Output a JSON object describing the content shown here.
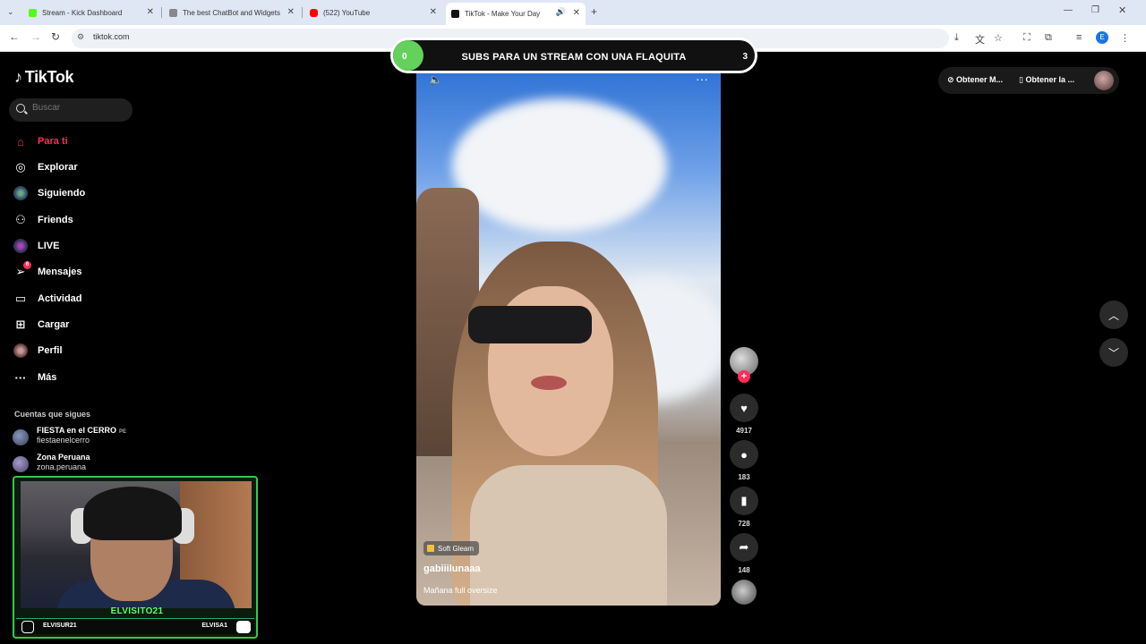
{
  "browser": {
    "tabs": [
      {
        "title": "Stream - Kick Dashboard",
        "favicon_color": "#53fc18"
      },
      {
        "title": "The best ChatBot and Widgets",
        "favicon_color": "#888888"
      },
      {
        "title": "(522) YouTube",
        "favicon_color": "#ff0000"
      },
      {
        "title": "TikTok - Make Your Day",
        "favicon_color": "#111111"
      }
    ],
    "url": "tiktok.com",
    "profile_initial": "E"
  },
  "sidebar": {
    "logo": "TikTok",
    "search_placeholder": "Buscar",
    "items": [
      {
        "label": "Para ti",
        "icon": "home-icon"
      },
      {
        "label": "Explorar",
        "icon": "compass-icon"
      },
      {
        "label": "Siguiendo",
        "icon": "following-icon"
      },
      {
        "label": "Friends",
        "icon": "friends-icon"
      },
      {
        "label": "LIVE",
        "icon": "live-icon"
      },
      {
        "label": "Mensajes",
        "icon": "message-icon",
        "badge": "6"
      },
      {
        "label": "Actividad",
        "icon": "activity-icon"
      },
      {
        "label": "Cargar",
        "icon": "upload-icon"
      },
      {
        "label": "Perfil",
        "icon": "profile-icon"
      },
      {
        "label": "Más",
        "icon": "more-icon"
      }
    ],
    "following_title": "Cuentas que sigues",
    "accounts": [
      {
        "name": "FIESTA en el CERRO",
        "tag": "PE",
        "handle": "fiestaenelcerro"
      },
      {
        "name": "Zona Peruana",
        "handle": "zona.peruana"
      }
    ]
  },
  "overlay": {
    "goal_current": "0",
    "goal_text": "SUBS PARA UN STREAM CON UNA FLAQUITA",
    "goal_target": "3",
    "cam_name": "ELVISITO21",
    "cam_social_left": "ELVISUR21",
    "cam_social_right": "ELVISA1"
  },
  "video": {
    "effect": "Soft Gleam",
    "author": "gabiiilunaaa",
    "caption": "Mañana full oversize",
    "likes": "4917",
    "comments": "183",
    "saves": "728",
    "shares": "148"
  },
  "topright": {
    "btn1": "Obtener M...",
    "btn2": "Obtener la ..."
  }
}
